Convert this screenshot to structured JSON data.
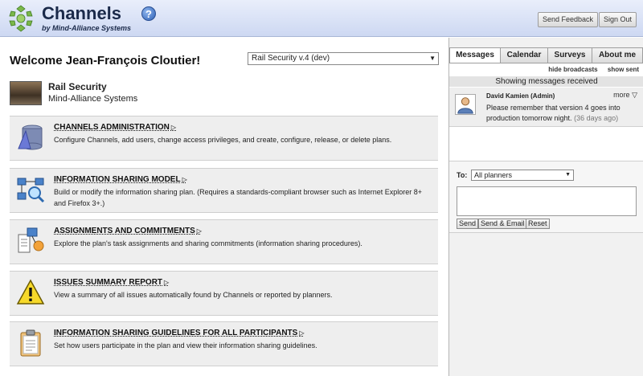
{
  "header": {
    "title": "Channels",
    "subtitle": "by Mind-Alliance Systems",
    "help_icon": "?",
    "send_feedback_label": "Send Feedback",
    "sign_out_label": "Sign Out"
  },
  "welcome": {
    "text": "Welcome Jean-François Cloutier!",
    "plan_selected": "Rail Security v.4 (dev)"
  },
  "plan": {
    "name": "Rail Security",
    "organization": "Mind-Alliance Systems"
  },
  "sections": [
    {
      "title": "CHANNELS ADMINISTRATION",
      "description": "Configure Channels, add users, change access privileges, and create, configure, release, or delete plans."
    },
    {
      "title": "INFORMATION SHARING MODEL",
      "description": "Build or modify the information sharing plan. (Requires a standards-compliant browser such as Internet Explorer 8+ and Firefox 3+.)"
    },
    {
      "title": "ASSIGNMENTS AND COMMITMENTS",
      "description": "Explore the plan's task assignments and sharing commitments (information sharing procedures)."
    },
    {
      "title": "ISSUES SUMMARY REPORT",
      "description": "View a summary of all issues automatically found by Channels or reported by planners."
    },
    {
      "title": "INFORMATION SHARING GUIDELINES FOR ALL PARTICIPANTS",
      "description": "Set how users participate in the plan and view their information sharing guidelines."
    }
  ],
  "tabs": [
    {
      "label": "Messages",
      "active": true
    },
    {
      "label": "Calendar",
      "active": false
    },
    {
      "label": "Surveys",
      "active": false
    },
    {
      "label": "About me",
      "active": false
    }
  ],
  "messages": {
    "hide_broadcasts": "hide broadcasts",
    "show_sent": "show sent",
    "header": "Showing messages received",
    "items": [
      {
        "from": "David Kamien (Admin)",
        "more": "more ▽",
        "text": "Please remember that version 4 goes into production tomorrow night.",
        "age": "(36 days ago)"
      }
    ]
  },
  "compose": {
    "to_label": "To:",
    "to_selected": "All planners",
    "send_label": "Send",
    "send_email_label": "Send & Email",
    "reset_label": "Reset"
  }
}
